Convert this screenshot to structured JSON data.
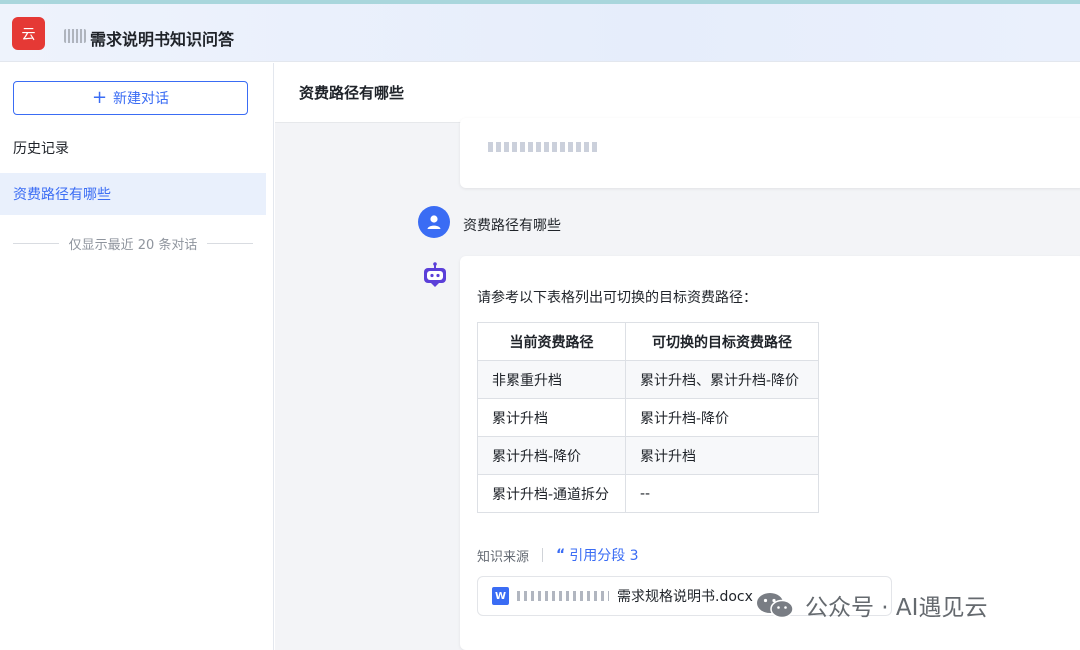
{
  "header": {
    "logo_text": "云",
    "title": "需求说明书知识问答"
  },
  "sidebar": {
    "new_chat_label": "新建对话",
    "history_label": "历史记录",
    "items": [
      {
        "label": "资费路径有哪些",
        "active": true
      }
    ],
    "limit_note": "仅显示最近 20 条对话"
  },
  "main": {
    "title": "资费路径有哪些",
    "user_question": "资费路径有哪些",
    "answer": {
      "intro": "请参考以下表格列出可切换的目标资费路径：",
      "table": {
        "headers": [
          "当前资费路径",
          "可切换的目标资费路径"
        ],
        "rows": [
          [
            "非累重升档",
            "累计升档、累计升档-降价"
          ],
          [
            "累计升档",
            "累计升档-降价"
          ],
          [
            "累计升档-降价",
            "累计升档"
          ],
          [
            "累计升档-通道拆分",
            "--"
          ]
        ]
      },
      "source_label": "知识来源",
      "citation_label": "引用分段 3",
      "document_name": "需求规格说明书.docx"
    }
  },
  "watermark": "公众号 · AI遇见云",
  "colors": {
    "accent": "#3a6cf4",
    "logo": "#e53935",
    "active_bg": "#e9f0fc"
  }
}
